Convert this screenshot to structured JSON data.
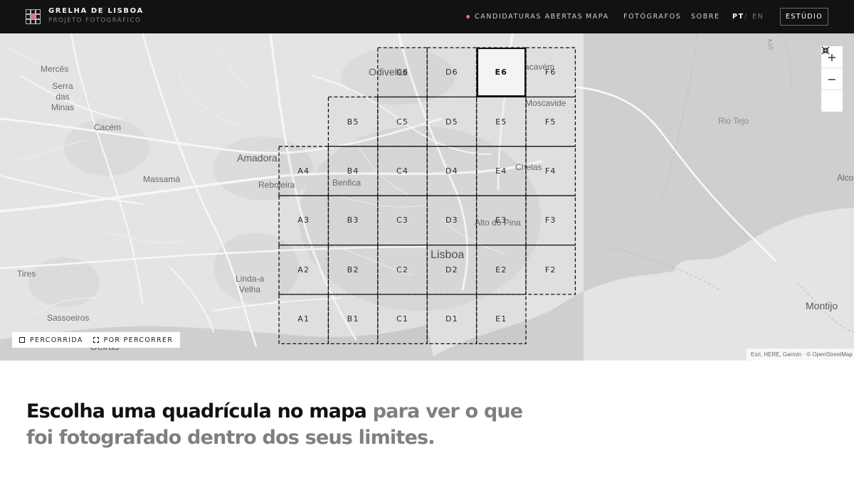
{
  "header": {
    "title": "GRELHA DE LISBOA",
    "subtitle": "PROJETO FOTOGRÁFICO",
    "open_calls": "CANDIDATURAS ABERTAS",
    "open_calls_dot_color": "#e0728d",
    "nav": {
      "map": "MAPA",
      "photographers": "FOTÓGRAFOS",
      "about": "SOBRE"
    },
    "lang": {
      "pt": "PT",
      "sep": "/",
      "en": "EN",
      "active": "PT"
    },
    "studio_button": "ESTÚDIO"
  },
  "map": {
    "places": {
      "mercês": "Mercês",
      "serra": "Serra\ndas\nMinas",
      "cacem": "Cacém",
      "massama": "Massamá",
      "amadora": "Amadora",
      "reboleira": "Reboleira",
      "benfica": "Benfica",
      "odivelas": "Odivelas",
      "sacavem": "Sacavém",
      "moscavide": "Moscavide",
      "chelas": "Chelas",
      "alto_pina": "Alto do Pina",
      "lisboa": "Lisboa",
      "linda": "Linda-a\nVelha",
      "tires": "Tires",
      "sassoeiros": "Sassoeiros",
      "oeiras": "Oeiras",
      "rio_tejo": "Rio Tejo",
      "alco": "Alco",
      "montijo": "Montijo",
      "road_label": "A10"
    },
    "grid": [
      {
        "id": "C6",
        "status": "por_percorrer"
      },
      {
        "id": "D6",
        "status": "por_percorrer"
      },
      {
        "id": "E6",
        "status": "percorrida"
      },
      {
        "id": "F6",
        "status": "por_percorrer"
      },
      {
        "id": "B5",
        "status": "por_percorrer"
      },
      {
        "id": "C5",
        "status": "por_percorrer"
      },
      {
        "id": "D5",
        "status": "por_percorrer"
      },
      {
        "id": "E5",
        "status": "por_percorrer"
      },
      {
        "id": "F5",
        "status": "por_percorrer"
      },
      {
        "id": "A4",
        "status": "por_percorrer"
      },
      {
        "id": "B4",
        "status": "por_percorrer"
      },
      {
        "id": "C4",
        "status": "por_percorrer"
      },
      {
        "id": "D4",
        "status": "por_percorrer"
      },
      {
        "id": "E4",
        "status": "por_percorrer"
      },
      {
        "id": "F4",
        "status": "por_percorrer"
      },
      {
        "id": "A3",
        "status": "por_percorrer"
      },
      {
        "id": "B3",
        "status": "por_percorrer"
      },
      {
        "id": "C3",
        "status": "por_percorrer"
      },
      {
        "id": "D3",
        "status": "por_percorrer"
      },
      {
        "id": "E3",
        "status": "por_percorrer"
      },
      {
        "id": "F3",
        "status": "por_percorrer"
      },
      {
        "id": "A2",
        "status": "por_percorrer"
      },
      {
        "id": "B2",
        "status": "por_percorrer"
      },
      {
        "id": "C2",
        "status": "por_percorrer"
      },
      {
        "id": "D2",
        "status": "por_percorrer"
      },
      {
        "id": "E2",
        "status": "por_percorrer"
      },
      {
        "id": "F2",
        "status": "por_percorrer"
      },
      {
        "id": "A1",
        "status": "por_percorrer"
      },
      {
        "id": "B1",
        "status": "por_percorrer"
      },
      {
        "id": "C1",
        "status": "por_percorrer"
      },
      {
        "id": "D1",
        "status": "por_percorrer"
      },
      {
        "id": "E1",
        "status": "por_percorrer"
      }
    ],
    "selected_cell": "E6",
    "zoom_controls": {
      "in": "+",
      "out": "−",
      "fit": "⤧"
    },
    "legend": {
      "walked": "PERCORRIDA",
      "to_walk": "POR PERCORRER"
    },
    "attribution": "Esri, HERE, Garmin · © OpenStreetMap"
  },
  "intro": {
    "strong": "Escolha uma quadrícula no mapa",
    "muted": " para ver o que foi fotografado dentro dos seus limites."
  }
}
